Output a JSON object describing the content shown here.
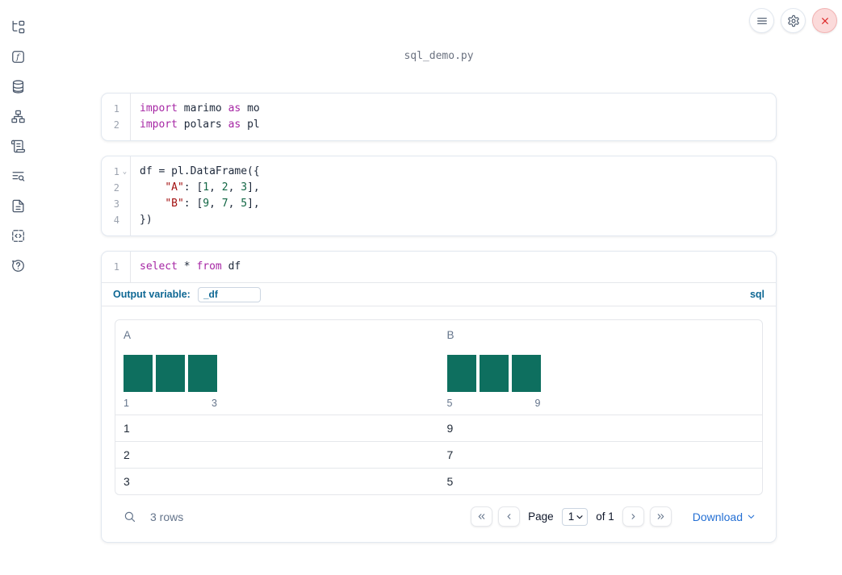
{
  "notebook": {
    "filename": "sql_demo.py"
  },
  "topbar": {
    "buttons": [
      {
        "name": "menu-button",
        "icon": "hamburger-icon"
      },
      {
        "name": "settings-button",
        "icon": "gear-icon"
      },
      {
        "name": "shutdown-button",
        "icon": "close-x-icon"
      }
    ]
  },
  "sidebar": {
    "items": [
      {
        "id": "file-explorer",
        "icon": "file-tree-icon"
      },
      {
        "id": "scratchpad",
        "icon": "function-icon"
      },
      {
        "id": "data-sources",
        "icon": "database-icon"
      },
      {
        "id": "dependencies",
        "icon": "network-graph-icon"
      },
      {
        "id": "logs",
        "icon": "scroll-icon"
      },
      {
        "id": "table-of-contents",
        "icon": "list-search-icon"
      },
      {
        "id": "documentation",
        "icon": "document-icon"
      },
      {
        "id": "snippets",
        "icon": "code-snippet-icon"
      },
      {
        "id": "help",
        "icon": "help-bubble-icon"
      }
    ]
  },
  "cells": [
    {
      "type": "python",
      "lines": [
        {
          "n": "1",
          "tokens": [
            {
              "t": "kw",
              "v": "import"
            },
            {
              "t": "pl",
              "v": " marimo "
            },
            {
              "t": "kw",
              "v": "as"
            },
            {
              "t": "pl",
              "v": " mo"
            }
          ]
        },
        {
          "n": "2",
          "tokens": [
            {
              "t": "kw",
              "v": "import"
            },
            {
              "t": "pl",
              "v": " polars "
            },
            {
              "t": "kw",
              "v": "as"
            },
            {
              "t": "pl",
              "v": " pl"
            }
          ]
        }
      ]
    },
    {
      "type": "python",
      "lines": [
        {
          "n": "1",
          "fold": true,
          "tokens": [
            {
              "t": "pl",
              "v": "df = pl.DataFrame({"
            }
          ]
        },
        {
          "n": "2",
          "tokens": [
            {
              "t": "pl",
              "v": "    "
            },
            {
              "t": "str",
              "v": "\"A\""
            },
            {
              "t": "pl",
              "v": ": ["
            },
            {
              "t": "num",
              "v": "1"
            },
            {
              "t": "pl",
              "v": ", "
            },
            {
              "t": "num",
              "v": "2"
            },
            {
              "t": "pl",
              "v": ", "
            },
            {
              "t": "num",
              "v": "3"
            },
            {
              "t": "pl",
              "v": "],"
            }
          ]
        },
        {
          "n": "3",
          "tokens": [
            {
              "t": "pl",
              "v": "    "
            },
            {
              "t": "str",
              "v": "\"B\""
            },
            {
              "t": "pl",
              "v": ": ["
            },
            {
              "t": "num",
              "v": "9"
            },
            {
              "t": "pl",
              "v": ", "
            },
            {
              "t": "num",
              "v": "7"
            },
            {
              "t": "pl",
              "v": ", "
            },
            {
              "t": "num",
              "v": "5"
            },
            {
              "t": "pl",
              "v": "],"
            }
          ]
        },
        {
          "n": "4",
          "tokens": [
            {
              "t": "pl",
              "v": "})"
            }
          ]
        }
      ]
    },
    {
      "type": "sql",
      "lines": [
        {
          "n": "1",
          "tokens": [
            {
              "t": "kw",
              "v": "select"
            },
            {
              "t": "pl",
              "v": " * "
            },
            {
              "t": "kw",
              "v": "from"
            },
            {
              "t": "pl",
              "v": " df"
            }
          ]
        }
      ],
      "output_variable_label": "Output variable:",
      "output_variable_value": "_df",
      "language_badge": "sql"
    }
  ],
  "output_table": {
    "columns": [
      {
        "name": "A",
        "hist": {
          "bars": [
            1,
            1,
            1
          ],
          "min_label": "1",
          "max_label": "3"
        }
      },
      {
        "name": "B",
        "hist": {
          "bars": [
            1,
            1,
            1
          ],
          "min_label": "5",
          "max_label": "9"
        }
      }
    ],
    "rows": [
      [
        "1",
        "9"
      ],
      [
        "2",
        "7"
      ],
      [
        "3",
        "5"
      ]
    ],
    "footer": {
      "row_count": "3 rows",
      "page_label": "Page",
      "page_value": "1",
      "of_label": "of 1",
      "download_label": "Download"
    }
  },
  "colors": {
    "histogram_bar": "#0e6f5f",
    "code_keyword": "#a626a4",
    "code_string": "#a31111",
    "code_number": "#116644",
    "sql_accent": "#0f6894",
    "link_blue": "#2570d4",
    "close_red": "#dc2626"
  }
}
